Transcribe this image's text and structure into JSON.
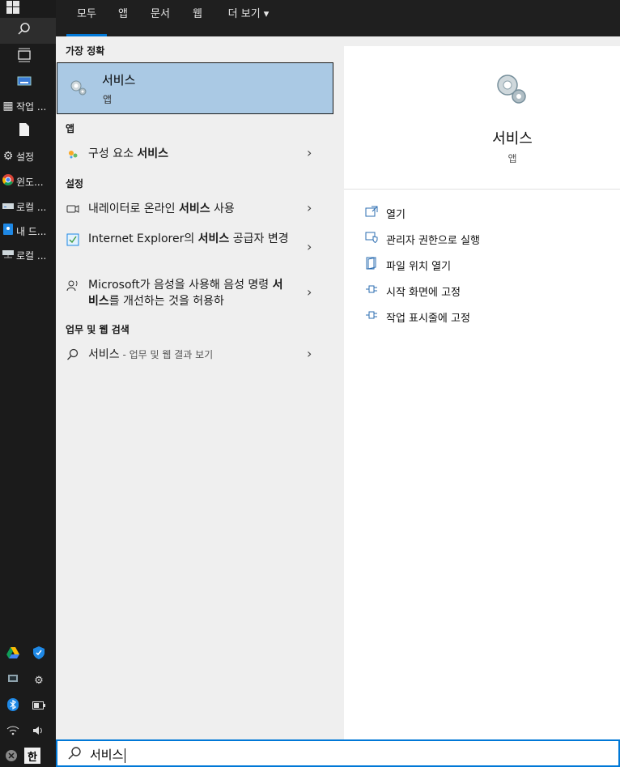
{
  "taskbar": {
    "items": [
      {
        "icon": "windows-icon",
        "label": ""
      },
      {
        "icon": "search-icon",
        "label": ""
      },
      {
        "icon": "task-view-icon",
        "label": ""
      },
      {
        "icon": "keyboard-icon",
        "label": ""
      },
      {
        "icon": "task-manager-icon",
        "label": "작업 ..."
      },
      {
        "icon": "file-icon",
        "label": ""
      },
      {
        "icon": "gear-icon",
        "label": "설정"
      },
      {
        "icon": "chrome-icon",
        "label": "윈도..."
      },
      {
        "icon": "drive-icon",
        "label": "로컬 ..."
      },
      {
        "icon": "this-pc-icon",
        "label": "내 드..."
      },
      {
        "icon": "network-drive-icon",
        "label": "로컬 ..."
      }
    ],
    "tray": {
      "ime_label": "한"
    }
  },
  "topnav": {
    "tabs": [
      "모두",
      "앱",
      "문서",
      "웹",
      "더 보기 ▾"
    ],
    "active": "모두"
  },
  "results": {
    "best_match_header": "가장 정확",
    "best_match": {
      "title": "서비스",
      "subtitle": "앱"
    },
    "apps_header": "앱",
    "apps": [
      {
        "pre": "구성 요소 ",
        "bold": "서비스",
        "post": ""
      }
    ],
    "settings_header": "설정",
    "settings": [
      {
        "pre": "내레이터로 온라인 ",
        "bold": "서비스",
        "post": " 사용"
      },
      {
        "pre": "Internet Explorer의 ",
        "bold": "서비스",
        "post": " 공급자 변경"
      },
      {
        "pre": "Microsoft가 음성을 사용해 음성 명령 ",
        "bold": "서비스",
        "post": "를 개선하는 것을 허용하"
      }
    ],
    "web_header": "업무 및 웹 검색",
    "web": {
      "term": "서비스",
      "suffix": " - 업무 및 웹 결과 보기"
    }
  },
  "detail": {
    "title": "서비스",
    "subtitle": "앱",
    "actions": [
      {
        "icon": "open-icon",
        "label": "열기"
      },
      {
        "icon": "shield-icon",
        "label": "관리자 권한으로 실행"
      },
      {
        "icon": "file-location-icon",
        "label": "파일 위치 열기"
      },
      {
        "icon": "pin-icon",
        "label": "시작 화면에 고정"
      },
      {
        "icon": "pin-icon",
        "label": "작업 표시줄에 고정"
      }
    ]
  },
  "search": {
    "query": "서비스"
  }
}
